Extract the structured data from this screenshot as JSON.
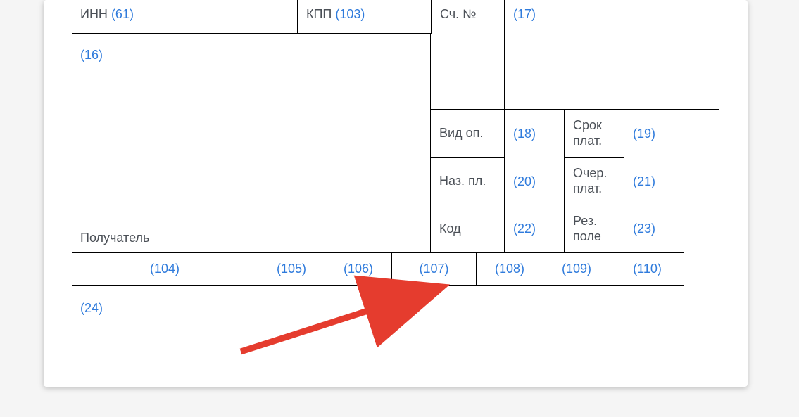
{
  "row1": {
    "inn_label": "ИНН ",
    "inn_ref": "(61)",
    "kpp_label": "КПП ",
    "kpp_ref": "(103)",
    "sch_label": "Сч. №",
    "ref17": "(17)"
  },
  "ref16": "(16)",
  "detail": {
    "vidop": "Вид оп.",
    "ref18": "(18)",
    "srok": "Срок плат.",
    "ref19": "(19)",
    "nazpl": "Наз. пл.",
    "ref20": "(20)",
    "ocher": "Очер. плат.",
    "ref21": "(21)",
    "kod": "Код",
    "ref22": "(22)",
    "rez": "Рез. поле",
    "ref23": "(23)"
  },
  "recipient": "Получатель",
  "bottomRefs": {
    "r104": "(104)",
    "r105": "(105)",
    "r106": "(106)",
    "r107": "(107)",
    "r108": "(108)",
    "r109": "(109)",
    "r110": "(110)"
  },
  "ref24": "(24)"
}
